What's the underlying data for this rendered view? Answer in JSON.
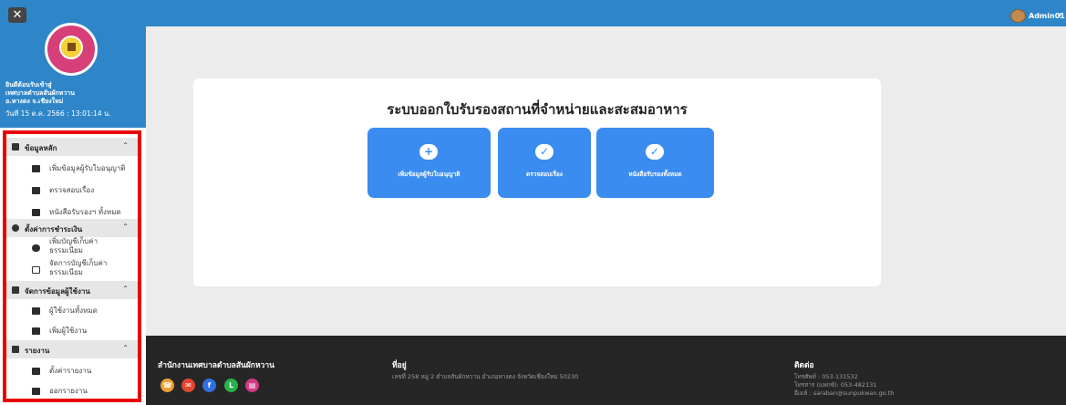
{
  "sidebar": {
    "close_label": "✕",
    "welcome": {
      "line1": "ยินดีต้อนรับเข้าสู่",
      "line2": "เทศบาลตำบลสันผักหวาน",
      "line3": "อ.หางดง จ.เชียงใหม่",
      "date": "วันที่ 15 ต.ค. 2566 : 13:01:14 น."
    },
    "sections": [
      {
        "label": "ข้อมูลหลัก",
        "icon": "database-icon"
      },
      {
        "label": "ตั้งค่าการชำระเงิน",
        "icon": "gear-icon"
      },
      {
        "label": "จัดการข้อมูลผู้ใช้งาน",
        "icon": "users-icon"
      },
      {
        "label": "รายงาน",
        "icon": "chart-icon"
      }
    ],
    "items": [
      {
        "label": "เพิ่มข้อมูลผู้รับใบอนุญาติ",
        "icon": "check-square-icon"
      },
      {
        "label": "ตรวจสอบเรื่อง",
        "icon": "check-square-icon"
      },
      {
        "label": "หนังสือรับรองฯ ทั้งหมด",
        "icon": "document-icon"
      },
      {
        "label1": "เพิ่มบัญชีเก็บค่า",
        "label2": "ธรรมเนียม",
        "icon": "cloud-icon"
      },
      {
        "label1": "จัดการบัญชีเก็บค่า",
        "label2": "ธรรมเนียม",
        "icon": "money-icon"
      },
      {
        "label": "ผู้ใช้งานทั้งหมด",
        "icon": "user-gear-icon"
      },
      {
        "label": "เพิ่มผู้ใช้งาน",
        "icon": "user-plus-icon"
      },
      {
        "label": "ตั้งค่ารายงาน",
        "icon": "printer-icon"
      },
      {
        "label": "ออกรายงาน",
        "icon": "printer-icon"
      }
    ]
  },
  "header": {
    "username": "Admin01",
    "caret": "▾"
  },
  "main": {
    "title": "ระบบออกใบรับรองสถานที่จำหน่ายและสะสมอาหาร",
    "tiles": [
      {
        "label": "เพิ่มข้อมูลผู้รับใบอนุญาติ",
        "icon": "plus-circle-icon",
        "glyph": "+"
      },
      {
        "label": "ตรวจสอบเรื่อง",
        "icon": "cloud-check-icon",
        "glyph": "✓"
      },
      {
        "label": "หนังสือรับรองทั้งหมด",
        "icon": "cloud-check-icon",
        "glyph": "✓"
      }
    ]
  },
  "footer": {
    "org": "สำนักงานเทศบาลตำบลสันผักหวาน",
    "address_title": "ที่อยู่",
    "address": "เลขที่ 258 หมู่ 2 ตำบลสันผักหวาน อำเภอหางดง จังหวัดเชียงใหม่ 50230",
    "contact_title": "ติดต่อ",
    "phone": "โทรศัพท์ : 053-131532",
    "fax": "โทรสาร (แฟกซ์): 053-482131",
    "email": "อีเมล์ : saraban@sunpukwan.go.th",
    "social_colors": [
      "#f0a030",
      "#e2452e",
      "#2f6fe0",
      "#27b24a",
      "#d33a84"
    ]
  },
  "colors": {
    "accent": "#2e86c9",
    "tile": "#3a8cf0",
    "footer": "#262626",
    "highlight": "#e80000"
  }
}
